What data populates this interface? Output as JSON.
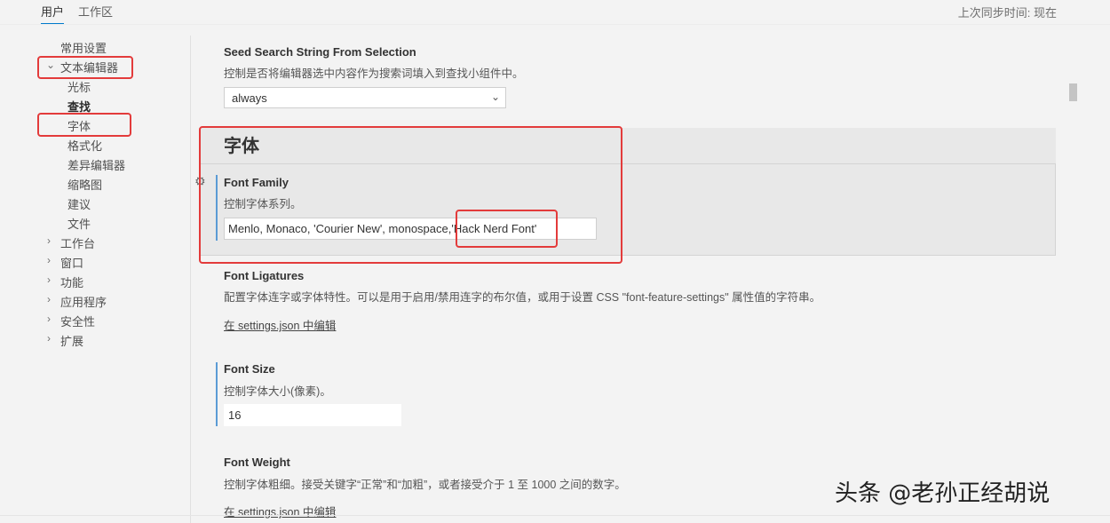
{
  "tabs": {
    "user": "用户",
    "workspace": "工作区"
  },
  "sync_status": "上次同步时间: 现在",
  "toc": {
    "common": "常用设置",
    "text_editor": "文本编辑器",
    "cursor": "光标",
    "find": "查找",
    "font": "字体",
    "formatting": "格式化",
    "diff_editor": "差异编辑器",
    "minimap": "缩略图",
    "suggestions": "建议",
    "files": "文件",
    "workbench": "工作台",
    "window": "窗口",
    "features": "功能",
    "application": "应用程序",
    "security": "安全性",
    "extensions": "扩展"
  },
  "seed_search": {
    "title": "Seed Search String From Selection",
    "desc": "控制是否将编辑器选中内容作为搜索词填入到查找小组件中。",
    "value": "always"
  },
  "section_title": "字体",
  "font_family": {
    "title": "Font Family",
    "desc": "控制字体系列。",
    "value": "Menlo, Monaco, 'Courier New', monospace,'Hack Nerd Font'"
  },
  "font_ligatures": {
    "title": "Font Ligatures",
    "desc": "配置字体连字或字体特性。可以是用于启用/禁用连字的布尔值，或用于设置 CSS \"font-feature-settings\" 属性值的字符串。",
    "link": "在 settings.json 中编辑"
  },
  "font_size": {
    "title": "Font Size",
    "desc": "控制字体大小(像素)。",
    "value": "16"
  },
  "font_weight": {
    "title": "Font Weight",
    "desc": "控制字体粗细。接受关键字“正常”和“加粗”，或者接受介于 1 至 1000 之间的数字。",
    "link": "在 settings.json 中编辑"
  },
  "watermark": "头条 @老孙正经胡说",
  "colors": {
    "accent": "#007acc",
    "highlight_box": "#e33b3b",
    "modified_bar": "#5b9bd5"
  }
}
